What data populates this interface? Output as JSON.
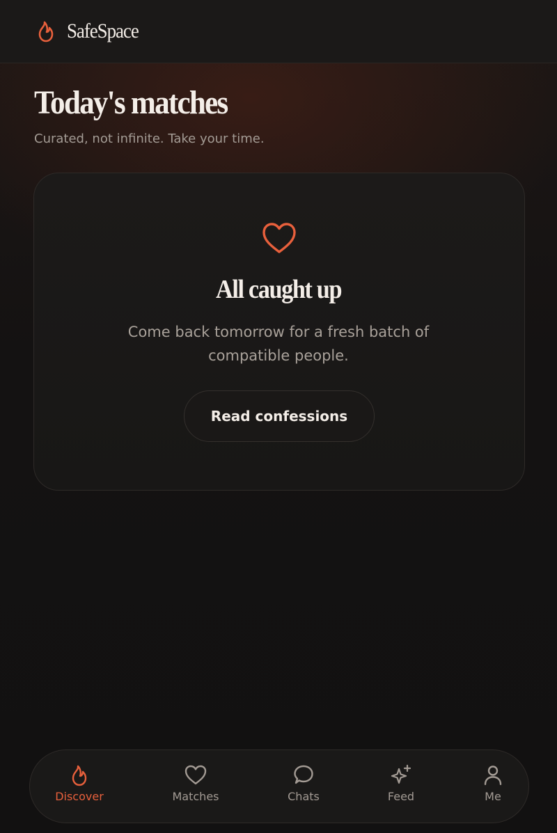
{
  "app": {
    "name": "SafeSpace",
    "brand_icon": "flame-icon",
    "accent_color": "#e8603c"
  },
  "page": {
    "title": "Today's matches",
    "subtitle": "Curated, not infinite. Take your time."
  },
  "empty_state": {
    "icon": "heart-icon",
    "title": "All caught up",
    "text": "Come back tomorrow for a fresh batch of compatible people.",
    "button_label": "Read confessions"
  },
  "nav": {
    "items": [
      {
        "label": "Discover",
        "icon": "flame-icon",
        "active": true
      },
      {
        "label": "Matches",
        "icon": "heart-icon",
        "active": false
      },
      {
        "label": "Chats",
        "icon": "chat-bubble-icon",
        "active": false
      },
      {
        "label": "Feed",
        "icon": "sparkles-icon",
        "active": false
      },
      {
        "label": "Me",
        "icon": "user-icon",
        "active": false
      }
    ]
  }
}
